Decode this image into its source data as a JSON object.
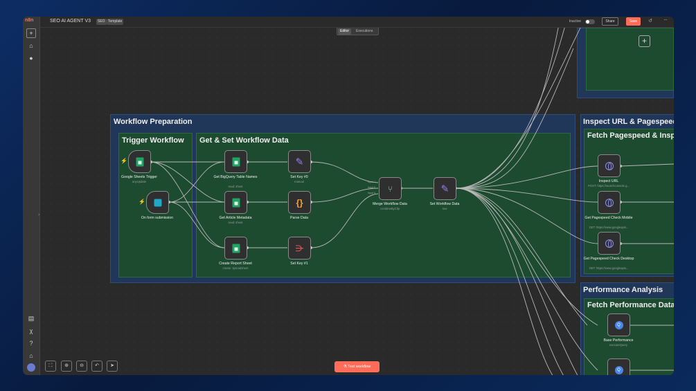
{
  "app": {
    "logo": "n8n"
  },
  "header": {
    "title": "SEO AI AGENT V3",
    "tags": [
      "SEO",
      "Template"
    ],
    "status_label": "Inactive",
    "share_label": "Share",
    "save_label": "Save"
  },
  "tabs": [
    {
      "label": "Editor",
      "active": true
    },
    {
      "label": "Executions",
      "active": false
    }
  ],
  "groups": {
    "workflow_preparation": "Workflow Preparation",
    "trigger_workflow": "Trigger Workflow",
    "get_set_data": "Get & Set Workflow Data",
    "inspect_url": "Inspect URL & Pagespeed",
    "fetch_pagespeed": "Fetch Pagespeed & Inspe",
    "performance_analysis": "Performance Analysis",
    "fetch_performance": "Fetch Performance Data"
  },
  "nodes": {
    "google_sheets_trigger": {
      "label": "Google Sheets Trigger",
      "sub": "anyUpdate"
    },
    "form_submission": {
      "label": "On form submission",
      "sub": ""
    },
    "bigquery_table_names": {
      "label": "Get BigQuery Table Names",
      "sub": "read: sheet"
    },
    "article_metadata": {
      "label": "Get Article Metadata",
      "sub": "read: sheet"
    },
    "create_report_sheet": {
      "label": "Create Report Sheet",
      "sub": "create: spreadsheet"
    },
    "set_key_0": {
      "label": "Set Key #0",
      "sub": "manual"
    },
    "parse_data": {
      "label": "Parse Data",
      "sub": ""
    },
    "set_key_1": {
      "label": "Set Key #1",
      "sub": ""
    },
    "merge_workflow_data": {
      "label": "Merge Workflow Data",
      "sub": "combineByClip",
      "ports": [
        "Input 1",
        "Input 2",
        "Input 3"
      ]
    },
    "set_workflow_data": {
      "label": "Set Workflow Data",
      "sub": "raw"
    },
    "inspect_url": {
      "label": "Inspect URL",
      "sub": "POST: https://searchconsole.g..."
    },
    "pagespeed_mobile": {
      "label": "Get Pagespeed Check Mobile",
      "sub": "GET: https://www.googleapis..."
    },
    "pagespeed_desktop": {
      "label": "Get Pagespeed Check Desktop",
      "sub": "GET: https://www.googleapis..."
    },
    "base_performance": {
      "label": "Base Performance",
      "sub": "executeQuery"
    }
  },
  "footer": {
    "test_workflow_label": "Test workflow"
  },
  "icons": {
    "sidebar": [
      "plus-icon",
      "home-icon",
      "user-icon",
      "templates-icon",
      "variables-icon",
      "help-icon",
      "whats-new-icon",
      "avatar"
    ],
    "controls": [
      "fit-view-icon",
      "zoom-in-icon",
      "zoom-out-icon",
      "reset-icon",
      "cursor-icon"
    ]
  },
  "colors": {
    "accent": "#ff6d5a",
    "sticky_blue": "#20375a",
    "sticky_green": "#1d4b2f"
  }
}
